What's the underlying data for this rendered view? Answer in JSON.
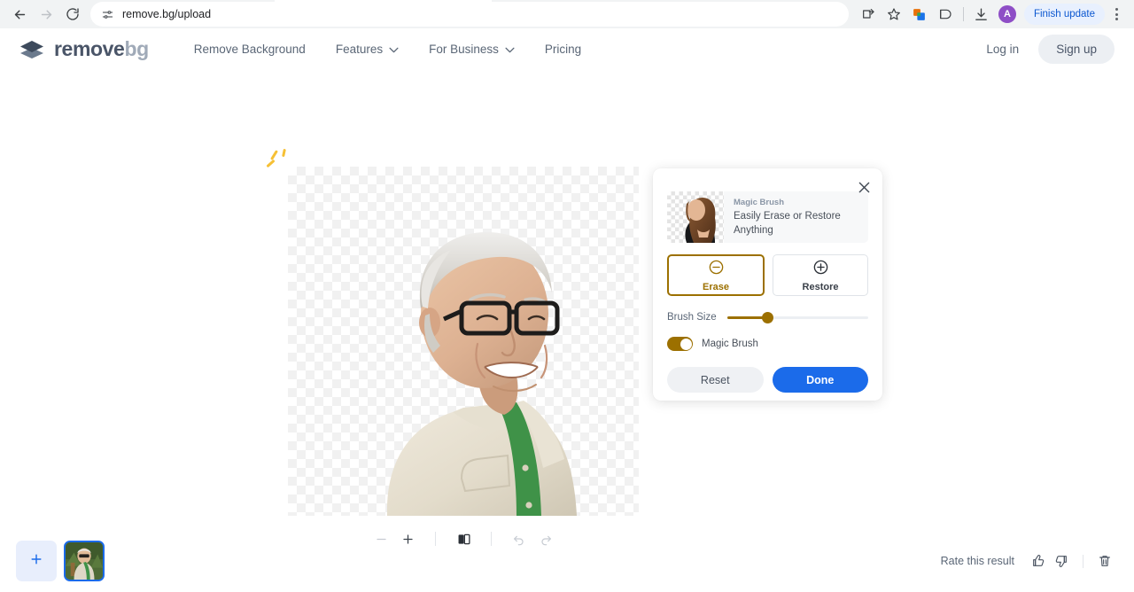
{
  "browser": {
    "url": "remove.bg/upload",
    "back_icon": "back-arrow-icon",
    "forward_icon": "forward-arrow-icon",
    "reload_icon": "reload-icon",
    "site_settings_icon": "page-settings-icon",
    "cast_icon": "cast-icon",
    "bookmark_icon": "star-icon",
    "extension_icon": "extension-puzzle-icon",
    "split_icon": "split-view-icon",
    "download_icon": "download-icon",
    "profile_initial": "A",
    "finish_update_label": "Finish update",
    "menu_icon": "three-dot-menu-icon"
  },
  "header": {
    "logo": {
      "primary": "remove",
      "secondary": "bg",
      "icon": "layers-diamond-logo"
    },
    "nav": [
      {
        "label": "Remove Background",
        "has_dropdown": false
      },
      {
        "label": "Features",
        "has_dropdown": true
      },
      {
        "label": "For Business",
        "has_dropdown": true
      },
      {
        "label": "Pricing",
        "has_dropdown": false
      }
    ],
    "login_label": "Log in",
    "signup_label": "Sign up"
  },
  "workspace": {
    "loading_indicator": "sparkle-loading-icon",
    "canvas_alt": "cut-out photo of smiling elderly man with glasses on transparent checkerboard",
    "toolbar": [
      {
        "name": "zoom-out-button",
        "icon": "minus-icon",
        "disabled": true
      },
      {
        "name": "zoom-in-button",
        "icon": "plus-icon",
        "disabled": false
      },
      {
        "name": "compare-button",
        "icon": "compare-split-icon",
        "disabled": false
      },
      {
        "name": "undo-button",
        "icon": "undo-arrow-icon",
        "disabled": true
      },
      {
        "name": "redo-button",
        "icon": "redo-arrow-icon",
        "disabled": true
      }
    ]
  },
  "magic_brush_panel": {
    "close_icon": "close-x-icon",
    "promo": {
      "title": "Magic Brush",
      "subtitle": "Easily Erase or Restore Anything",
      "image_alt": "woman with long brown hair on transparent background"
    },
    "modes": [
      {
        "label": "Erase",
        "icon": "circle-minus-icon",
        "active": true
      },
      {
        "label": "Restore",
        "icon": "circle-plus-icon",
        "active": false
      }
    ],
    "brush_size_label": "Brush Size",
    "brush_size_value": 29,
    "magic_brush_toggle_label": "Magic Brush",
    "magic_brush_toggle_on": true,
    "reset_label": "Reset",
    "done_label": "Done",
    "accent_color": "#9c7000",
    "primary_color": "#1b6bea"
  },
  "bottom_bar": {
    "add_button_icon": "plus-icon",
    "thumbnail_alt": "original photo thumbnail of man outdoors",
    "rate_label": "Rate this result",
    "thumbs_up_icon": "thumbs-up-icon",
    "thumbs_down_icon": "thumbs-down-icon",
    "delete_icon": "trash-icon"
  }
}
